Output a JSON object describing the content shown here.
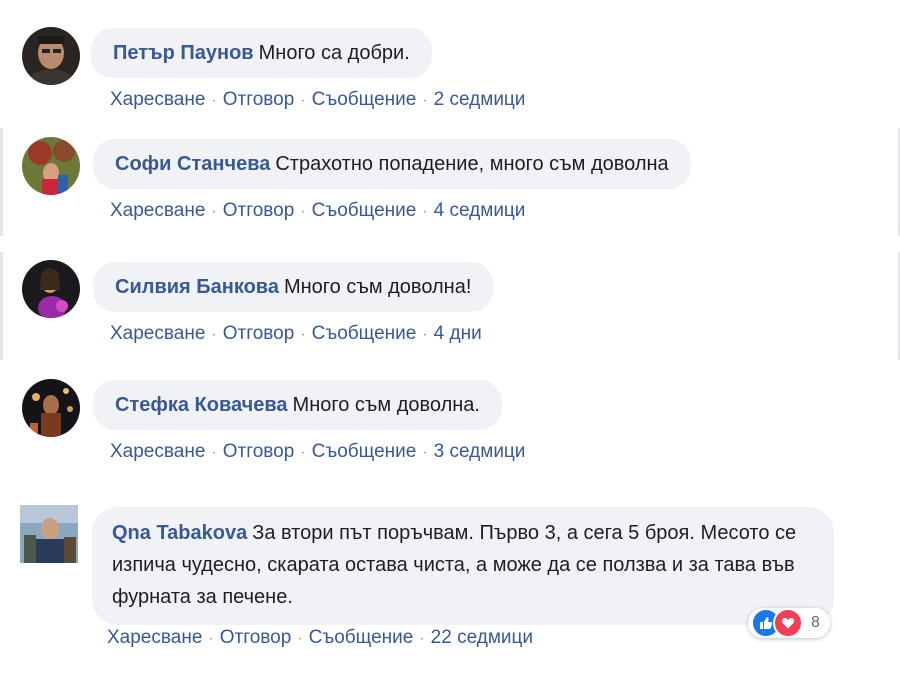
{
  "comments": [
    {
      "author": "Петър Паунов",
      "text": "Много са добри.",
      "actions": {
        "like": "Харесване",
        "reply": "Отговор",
        "message": "Съобщение",
        "time": "2 седмици"
      }
    },
    {
      "author": "Софи Станчева",
      "text": "Страхотно попадение, много съм доволна",
      "actions": {
        "like": "Харесване",
        "reply": "Отговор",
        "message": "Съобщение",
        "time": "4 седмици"
      }
    },
    {
      "author": "Силвия Банкова",
      "text": "Много съм доволна!",
      "actions": {
        "like": "Харесване",
        "reply": "Отговор",
        "message": "Съобщение",
        "time": "4 дни"
      }
    },
    {
      "author": "Стефка Ковачева",
      "text": "Много съм доволна.",
      "actions": {
        "like": "Харесване",
        "reply": "Отговор",
        "message": "Съобщение",
        "time": "3 седмици"
      }
    },
    {
      "author": "Qna Tabakova",
      "text": "За втори път поръчвам. Първо 3, а сега 5 броя. Месото се изпича чудесно, скарата остава чиста, а може да се ползва и за тава във фурната за печене.",
      "actions": {
        "like": "Харесване",
        "reply": "Отговор",
        "message": "Съобщение",
        "time": "22 седмици"
      },
      "reactions": {
        "icons": [
          "like-icon",
          "love-icon"
        ],
        "count": "8"
      }
    }
  ],
  "colors": {
    "author": "#385898",
    "bubble": "#f0f2f5",
    "text": "#1c1e21",
    "separator": "#90949c",
    "like": "#1877f2",
    "love": "#f33e58"
  }
}
